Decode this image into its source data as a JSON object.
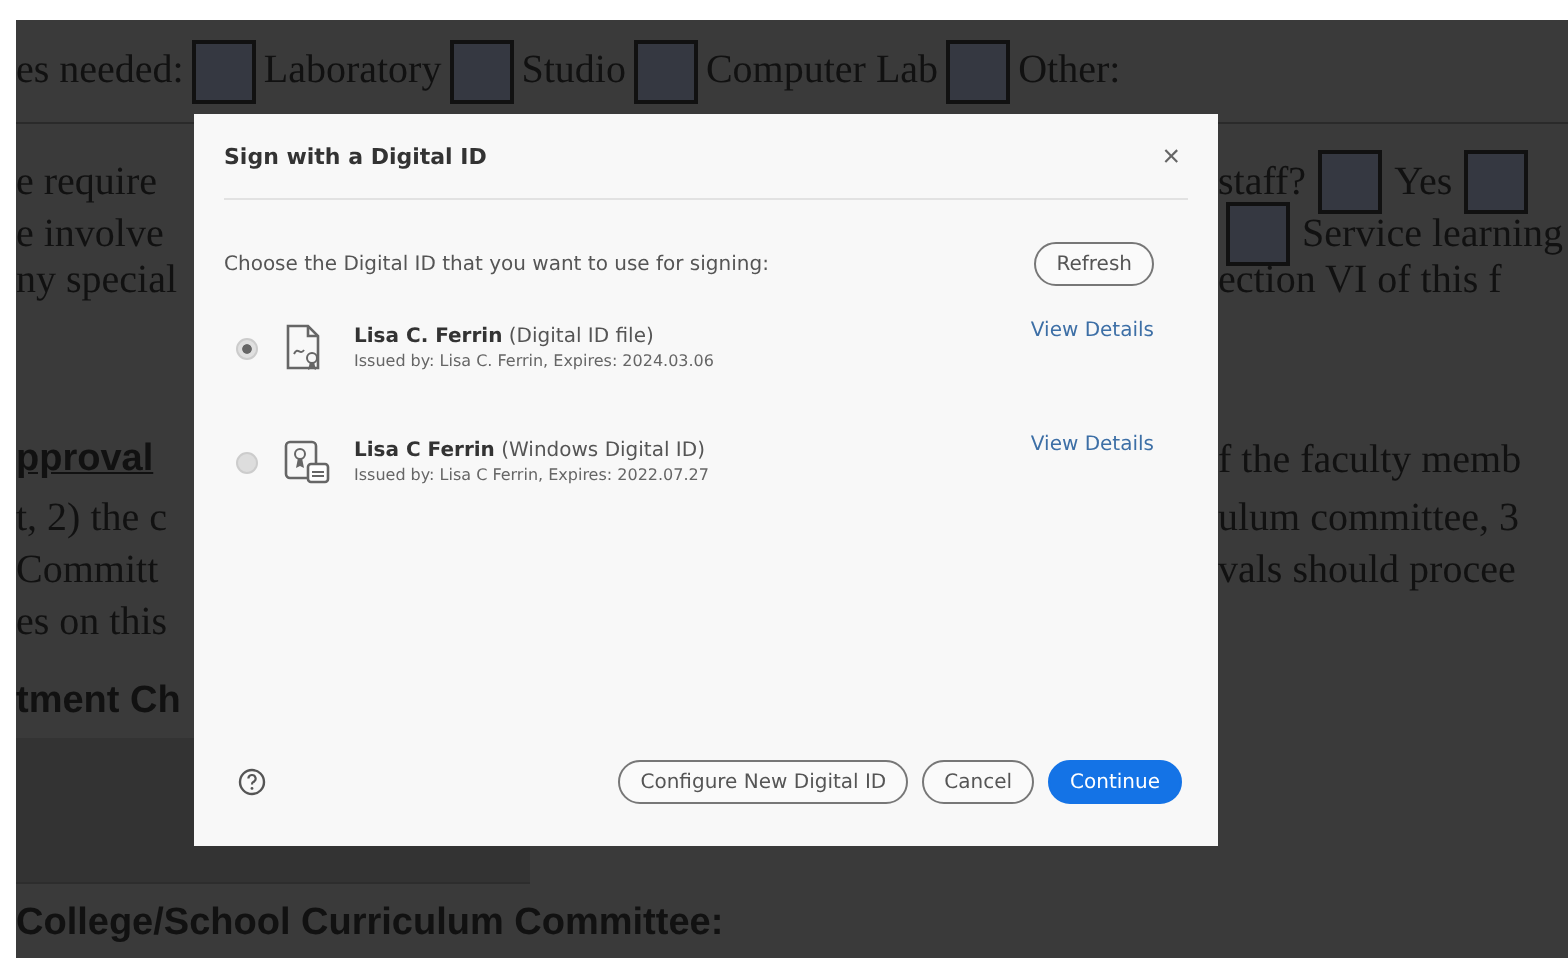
{
  "document": {
    "option_row": [
      {
        "kind": "text",
        "text": "es needed:"
      },
      {
        "kind": "box",
        "checked": false
      },
      {
        "kind": "text",
        "text": "Laboratory"
      },
      {
        "kind": "box",
        "checked": false
      },
      {
        "kind": "text",
        "text": "Studio"
      },
      {
        "kind": "box",
        "checked": false
      },
      {
        "kind": "text",
        "text": "Computer Lab"
      },
      {
        "kind": "box",
        "checked": false
      },
      {
        "kind": "text",
        "text": "Other:"
      }
    ],
    "rows": [
      {
        "kind": "line",
        "left": "e require",
        "right": [
          {
            "kind": "text",
            "text": "staff?"
          },
          {
            "kind": "box",
            "checked": false
          },
          {
            "kind": "text",
            "text": "Yes"
          },
          {
            "kind": "box",
            "checked": false
          }
        ]
      },
      {
        "kind": "line",
        "left": "e involve",
        "right": [
          {
            "kind": "box",
            "checked": false
          },
          {
            "kind": "text",
            "text": "Service learning"
          }
        ]
      },
      {
        "kind": "line",
        "left": "ny special",
        "right": [
          {
            "kind": "text",
            "text": "ection VI of this f"
          }
        ]
      },
      {
        "kind": "gap"
      },
      {
        "kind": "heading",
        "left": "pproval",
        "underline": true,
        "right": [
          {
            "kind": "text",
            "text": "f the faculty memb"
          }
        ]
      },
      {
        "kind": "line",
        "left": "t, 2) the c",
        "right": [
          {
            "kind": "text",
            "text": "ulum committee, 3"
          }
        ]
      },
      {
        "kind": "line",
        "left": "Committ",
        "right": [
          {
            "kind": "text",
            "text": "vals should procee"
          }
        ]
      },
      {
        "kind": "line",
        "left": "es on this",
        "right": []
      },
      {
        "kind": "heading",
        "left": "tment Ch",
        "underline": false,
        "right": []
      },
      {
        "kind": "panel"
      },
      {
        "kind": "heading",
        "left": "College/School Curriculum Committee:",
        "underline": false,
        "right": []
      }
    ]
  },
  "dialog": {
    "title": "Sign with a Digital ID",
    "close": "×",
    "prompt": "Choose the Digital ID that you want to use for signing:",
    "refresh": "Refresh",
    "ids": [
      {
        "name": "Lisa C. Ferrin",
        "type": "(Digital ID file)",
        "issued": "Issued by: Lisa C. Ferrin, Expires: 2024.03.06",
        "details": "View Details",
        "selected": true,
        "kind": "file"
      },
      {
        "name": "Lisa C Ferrin",
        "type": "(Windows Digital ID)",
        "issued": "Issued by: Lisa C Ferrin, Expires: 2022.07.27",
        "details": "View Details",
        "selected": false,
        "kind": "windows"
      }
    ],
    "buttons": [
      {
        "label": "Configure New Digital ID",
        "kind": "secondary"
      },
      {
        "label": "Cancel",
        "kind": "secondary"
      },
      {
        "label": "Continue",
        "kind": "primary"
      }
    ]
  }
}
